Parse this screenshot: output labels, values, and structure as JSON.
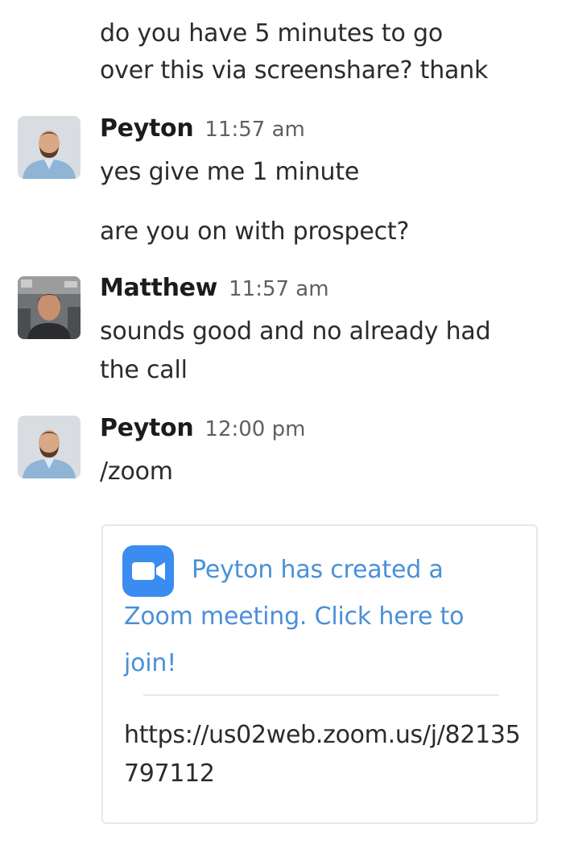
{
  "messages": [
    {
      "type": "continuation",
      "lines": [
        "do you have 5 minutes to go",
        "over this via screenshare? thank"
      ]
    },
    {
      "author": "Peyton",
      "time": "11:57 am",
      "avatar": "peyton-avatar",
      "lines": [
        "yes give me 1 minute"
      ],
      "followup": [
        "are you on with prospect?"
      ]
    },
    {
      "author": "Matthew",
      "time": "11:57 am",
      "avatar": "matthew-avatar",
      "lines": [
        "sounds good and no already had",
        "the call"
      ]
    },
    {
      "author": "Peyton",
      "time": "12:00 pm",
      "avatar": "peyton-avatar",
      "lines": [
        "/zoom"
      ]
    }
  ],
  "zoom_card": {
    "icon": "zoom-camera-icon",
    "title": "Peyton has created a Zoom meeting. Click here to join!",
    "url": "https://us02web.zoom.us/j/82135797112"
  },
  "colors": {
    "link": "#4a90d9",
    "zoom_brand": "#3b8cf0",
    "timestamp": "#616061"
  }
}
